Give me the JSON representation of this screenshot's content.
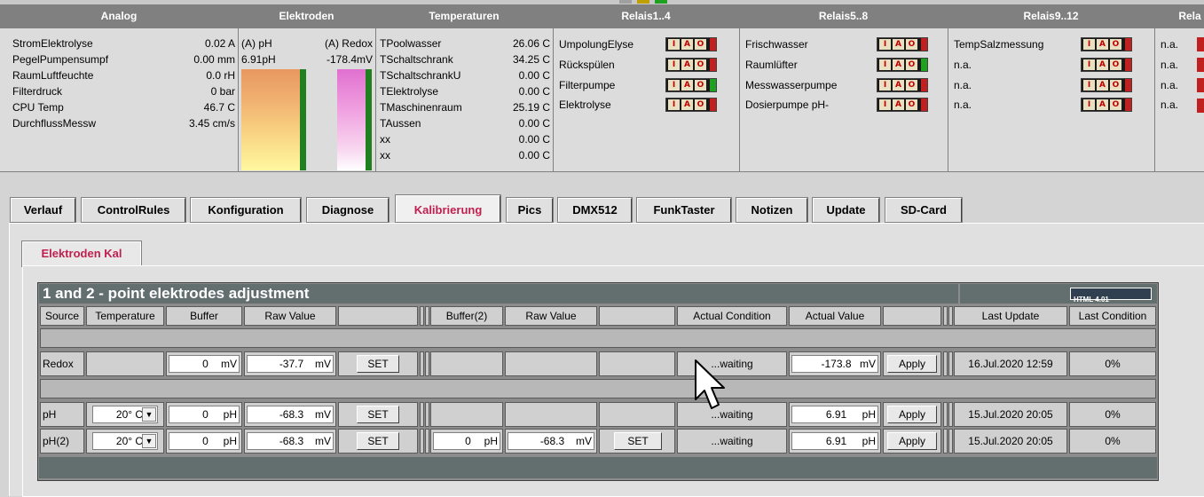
{
  "header": {
    "analog": "Analog",
    "elektroden": "Elektroden",
    "temperaturen": "Temperaturen",
    "relais1": "Relais1..4",
    "relais2": "Relais5..8",
    "relais3": "Relais9..12",
    "relais4": "Rela"
  },
  "analog": [
    {
      "name": "StromElektrolyse",
      "value": "0.02 A"
    },
    {
      "name": "PegelPumpensumpf",
      "value": "0.00 mm"
    },
    {
      "name": "RaumLuftfeuchte",
      "value": "0.0 rH"
    },
    {
      "name": "Filterdruck",
      "value": "0 bar"
    },
    {
      "name": "CPU Temp",
      "value": "46.7 C"
    },
    {
      "name": "DurchflussMessw",
      "value": "3.45 cm/s"
    }
  ],
  "electrodes": {
    "ph_label": "(A) pH",
    "ph_value": "6.91pH",
    "redox_label": "(A) Redox",
    "redox_value": "-178.4mV"
  },
  "temperatures": [
    {
      "name": "TPoolwasser",
      "value": "26.06 C"
    },
    {
      "name": "TSchaltschrank",
      "value": "34.25 C"
    },
    {
      "name": "TSchaltschrankU",
      "value": "0.00 C"
    },
    {
      "name": "TElektrolyse",
      "value": "0.00 C"
    },
    {
      "name": "TMaschinenraum",
      "value": "25.19 C"
    },
    {
      "name": "TAussen",
      "value": "0.00 C"
    },
    {
      "name": "xx",
      "value": "0.00 C"
    },
    {
      "name": "xx",
      "value": "0.00 C"
    }
  ],
  "relais1": [
    "UmpolungElyse",
    "Rückspülen",
    "Filterpumpe",
    "Elektrolyse"
  ],
  "relais2": [
    "Frischwasser",
    "Raumlüfter",
    "Messwasserpumpe",
    "Dosierpumpe pH-"
  ],
  "relais3": [
    "TempSalzmessung",
    "n.a.",
    "n.a.",
    "n.a."
  ],
  "relais4": [
    "n.a.",
    "n.a.",
    "n.a.",
    "n.a."
  ],
  "relais_letters": {
    "i": "I",
    "a": "A",
    "o": "O"
  },
  "colors": {
    "on": "#20a020",
    "off": "#c02020",
    "accent": "#c02050"
  },
  "tabs": [
    "Verlauf",
    "ControlRules",
    "Konfiguration",
    "Diagnose",
    "Kalibrierung",
    "Pics",
    "DMX512",
    "FunkTaster",
    "Notizen",
    "Update",
    "SD-Card"
  ],
  "subtab": "Elektroden Kal",
  "table": {
    "title": "1 and 2 - point elektrodes adjustment",
    "validator": "HTML 4.01",
    "headers": {
      "source": "Source",
      "temperature": "Temperature",
      "buffer": "Buffer",
      "raw": "Raw Value",
      "buffer2": "Buffer(2)",
      "raw2": "Raw Value",
      "cond": "Actual Condition",
      "actual": "Actual Value",
      "last": "Last Update",
      "lastcond": "Last Condition"
    },
    "rows": [
      {
        "source": "Redox",
        "temp": "",
        "buffer": "0",
        "bunit": "mV",
        "raw": "-37.7",
        "runit": "mV",
        "set": "SET",
        "cond": "...waiting",
        "actual": "-173.8",
        "aunit": "mV",
        "apply": "Apply",
        "last": "16.Jul.2020 12:59",
        "lastcond": "0%"
      },
      {
        "source": "pH",
        "temp": "20° C",
        "buffer": "0",
        "bunit": "pH",
        "raw": "-68.3",
        "runit": "mV",
        "set": "SET",
        "cond": "...waiting",
        "actual": "6.91",
        "aunit": "pH",
        "apply": "Apply",
        "last": "15.Jul.2020 20:05",
        "lastcond": "0%"
      },
      {
        "source": "pH(2)",
        "temp": "20° C",
        "buffer": "0",
        "bunit": "pH",
        "raw": "-68.3",
        "runit": "mV",
        "set": "SET",
        "buffer2": "0",
        "b2unit": "pH",
        "raw2": "-68.3",
        "r2unit": "mV",
        "set2": "SET",
        "cond": "...waiting",
        "actual": "6.91",
        "aunit": "pH",
        "apply": "Apply",
        "last": "15.Jul.2020 20:05",
        "lastcond": "0%"
      }
    ]
  }
}
